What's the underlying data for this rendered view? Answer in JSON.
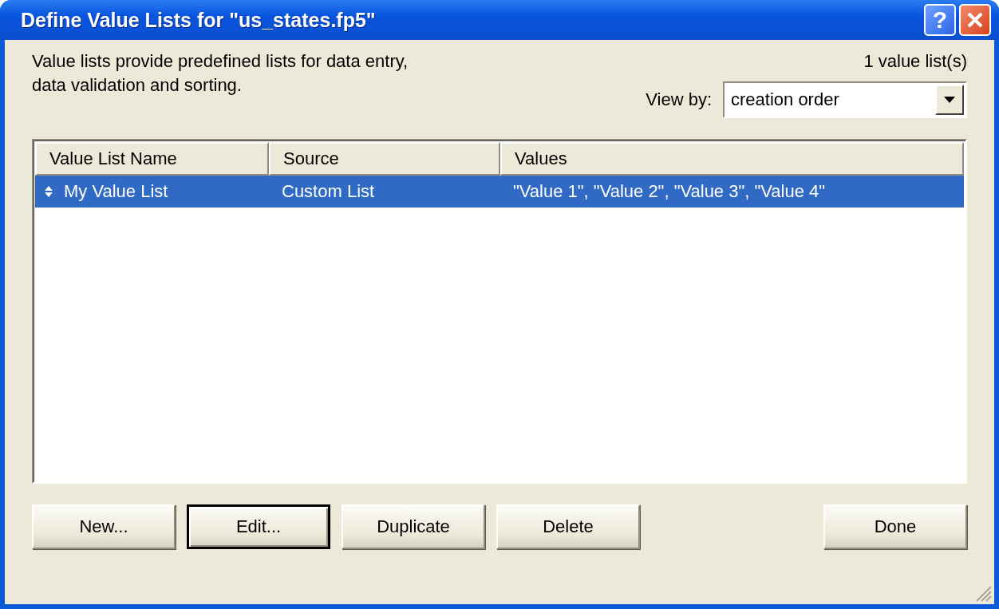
{
  "window": {
    "title": "Define Value Lists for \"us_states.fp5\"",
    "help_label": "?"
  },
  "description": "Value lists provide predefined lists for data entry,\ndata validation and sorting.",
  "count": "1 value list(s)",
  "view_by": {
    "label": "View by:",
    "value": "creation order"
  },
  "table": {
    "columns": [
      "Value List Name",
      "Source",
      "Values"
    ],
    "rows": [
      {
        "cells": [
          "My Value List",
          "Custom List",
          "\"Value 1\", \"Value 2\", \"Value 3\", \"Value 4\""
        ],
        "selected": true
      }
    ]
  },
  "buttons": [
    {
      "label": "New...",
      "default": false
    },
    {
      "label": "Edit...",
      "default": true
    },
    {
      "label": "Duplicate",
      "default": false
    },
    {
      "label": "Delete",
      "default": false
    }
  ],
  "done_button": {
    "label": "Done",
    "default": false
  }
}
